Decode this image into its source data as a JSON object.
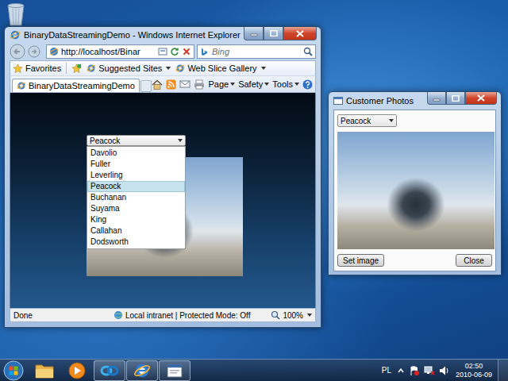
{
  "browser": {
    "title": "BinaryDataStreamingDemo - Windows Internet Explorer",
    "address": "http://localhost/Binar",
    "search_placeholder": "Bing",
    "favorites": {
      "label": "Favorites",
      "links": [
        {
          "label": "Suggested Sites",
          "has_menu": true
        },
        {
          "label": "Web Slice Gallery",
          "has_menu": true
        }
      ]
    },
    "tabs": [
      {
        "label": "BinaryDataStreamingDemo",
        "selected": true
      }
    ],
    "commands": [
      {
        "label": "Page",
        "has_menu": true
      },
      {
        "label": "Safety",
        "has_menu": true
      },
      {
        "label": "Tools",
        "has_menu": true
      }
    ],
    "page": {
      "combobox": {
        "value": "Peacock",
        "expanded": true,
        "options": [
          {
            "label": "Davolio",
            "selected": false
          },
          {
            "label": "Fuller",
            "selected": false
          },
          {
            "label": "Leverling",
            "selected": false
          },
          {
            "label": "Peacock",
            "selected": true
          },
          {
            "label": "Buchanan",
            "selected": false
          },
          {
            "label": "Suyama",
            "selected": false
          },
          {
            "label": "King",
            "selected": false
          },
          {
            "label": "Callahan",
            "selected": false
          },
          {
            "label": "Dodsworth",
            "selected": false
          }
        ]
      }
    },
    "status_bar": {
      "text": "Done",
      "zone": "Local intranet | Protected Mode: Off",
      "zoom": "100%"
    }
  },
  "photos_window": {
    "title": "Customer Photos",
    "combobox": {
      "value": "Peacock",
      "expanded": false
    },
    "buttons": [
      "Set image",
      "Close"
    ]
  },
  "taskbar": {
    "items": [
      {
        "kind": "explorer",
        "running": false
      },
      {
        "kind": "media-player",
        "running": false
      },
      {
        "kind": "app",
        "running": true
      },
      {
        "kind": "ie",
        "running": true
      },
      {
        "kind": "window",
        "running": true
      }
    ],
    "language": "PL",
    "time": "02:50",
    "date": "2010-06-09"
  }
}
